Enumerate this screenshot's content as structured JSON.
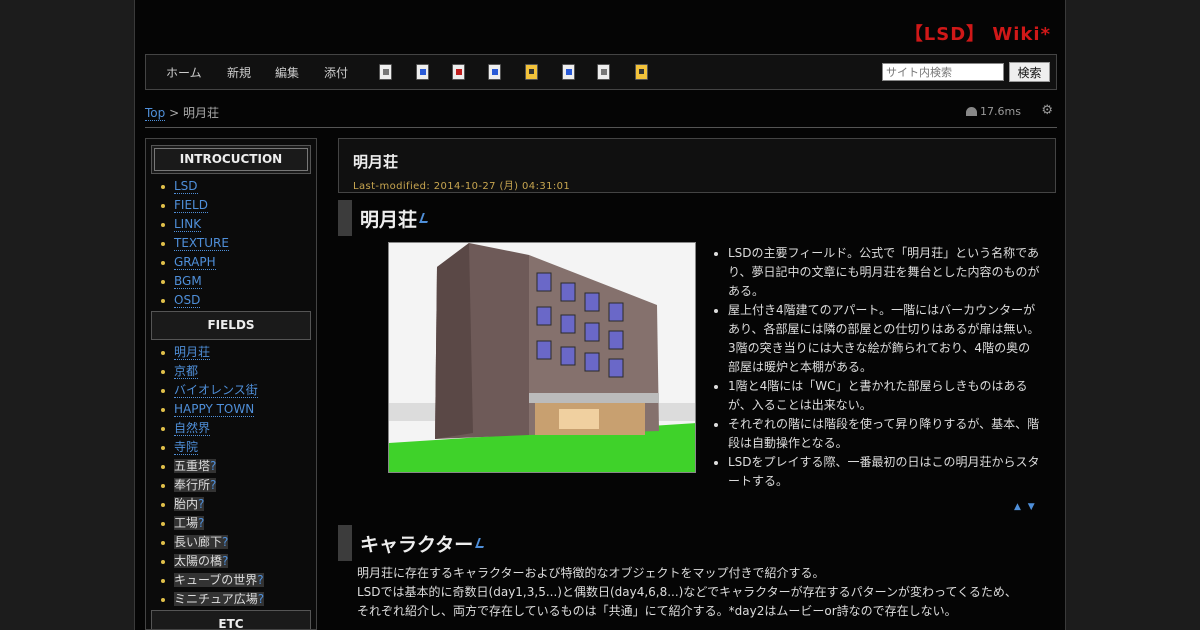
{
  "site": {
    "title": "【LSD】 Wiki*"
  },
  "nav": {
    "items": [
      "ホーム",
      "新規",
      "編集",
      "添付"
    ],
    "search_placeholder": "サイト内検索",
    "search_button": "検索"
  },
  "breadcrumb": {
    "top": "Top",
    "sep": ">",
    "current": "明月荘"
  },
  "timing": "17.6ms",
  "sidebar": {
    "sections": [
      {
        "title": "INTROCUCTION",
        "items": [
          {
            "label": "LSD",
            "link": true
          },
          {
            "label": "FIELD",
            "link": true
          },
          {
            "label": "LINK",
            "link": true
          },
          {
            "label": "TEXTURE",
            "link": true
          },
          {
            "label": "GRAPH",
            "link": true
          },
          {
            "label": "BGM",
            "link": true
          },
          {
            "label": "OSD",
            "link": true
          }
        ]
      },
      {
        "title": "FIELDS",
        "items": [
          {
            "label": "明月荘",
            "link": true
          },
          {
            "label": "京都",
            "link": true
          },
          {
            "label": "バイオレンス街",
            "link": true
          },
          {
            "label": "HAPPY TOWN",
            "link": true
          },
          {
            "label": "自然界",
            "link": true
          },
          {
            "label": "寺院",
            "link": true
          },
          {
            "label": "五重塔",
            "link": false
          },
          {
            "label": "奉行所",
            "link": false
          },
          {
            "label": "胎内",
            "link": false
          },
          {
            "label": "工場",
            "link": false
          },
          {
            "label": "長い廊下",
            "link": false
          },
          {
            "label": "太陽の橋",
            "link": false
          },
          {
            "label": "キューブの世界",
            "link": false
          },
          {
            "label": "ミニチュア広場",
            "link": false
          }
        ]
      },
      {
        "title": "ETC",
        "items": []
      }
    ]
  },
  "page": {
    "title": "明月荘",
    "last_modified": "Last-modified: 2014-10-27 (月) 04:31:01",
    "section1_heading": "明月荘",
    "bullets": [
      "LSDの主要フィールド。公式で「明月荘」という名称であり、夢日記中の文章にも明月荘を舞台とした内容のものがある。",
      "屋上付き4階建てのアパート。一階にはバーカウンターがあり、各部屋には隣の部屋との仕切りはあるが扉は無い。3階の突き当りには大きな絵が飾られており、4階の奥の部屋は暖炉と本棚がある。",
      "1階と4階には「WC」と書かれた部屋らしきものはあるが、入ることは出来ない。",
      "それぞれの階には階段を使って昇り降りするが、基本、階段は自動操作となる。",
      "LSDをプレイする際、一番最初の日はこの明月荘からスタートする。"
    ],
    "arrows": "▲ ▼",
    "section2_heading": "キャラクター",
    "section2_lines": [
      "明月荘に存在するキャラクターおよび特徴的なオブジェクトをマップ付きで紹介する。",
      "LSDでは基本的に奇数日(day1,3,5...)と偶数日(day4,6,8...)などでキャラクターが存在するパターンが変わってくるため、",
      "それぞれ紹介し、両方で存在しているものは「共通」にて紹介する。*day2はムービーor詩なので存在しない。"
    ]
  },
  "colors": {
    "title_red": "#d01818",
    "link_blue": "#4f8fd9",
    "bullet_yellow": "#e0c04a",
    "modified_gold": "#c8a650"
  }
}
